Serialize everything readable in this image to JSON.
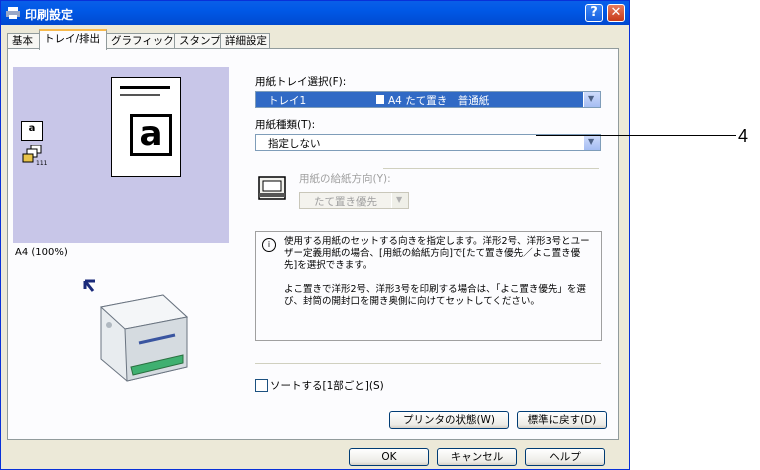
{
  "window": {
    "title": "印刷設定"
  },
  "tabs": [
    {
      "label": "基本"
    },
    {
      "label": "トレイ/排出"
    },
    {
      "label": "グラフィックス"
    },
    {
      "label": "スタンプ"
    },
    {
      "label": "詳細設定"
    }
  ],
  "preview": {
    "ratio_text": "A4 (100%)",
    "paper_letter": "a",
    "small_letter": "a"
  },
  "tray": {
    "label": "用紙トレイ選択(F):",
    "value_tray": "トレイ1",
    "value_detail": "A4 たて置き　普通紙"
  },
  "paper_type": {
    "label": "用紙種類(T):",
    "value": "指定しない"
  },
  "feed_direction": {
    "label": "用紙の給紙方向(Y):",
    "value": "たて置き優先"
  },
  "info": {
    "text1": "使用する用紙のセットする向きを指定します。洋形2号、洋形3号とユーザー定義用紙の場合、[用紙の給紙方向]で[たて置き優先／よこ置き優先]を選択できます。",
    "text2": "よこ置きで洋形2号、洋形3号を印刷する場合は、「よこ置き優先」を選び、封筒の開封口を開き奥側に向けてセットしてください。"
  },
  "sort": {
    "label": "ソートする[1部ごと](S)",
    "checked": false
  },
  "buttons": {
    "printer_status": "プリンタの状態(W)",
    "restore_defaults": "標準に戻す(D)",
    "ok": "OK",
    "cancel": "キャンセル",
    "help": "ヘルプ"
  },
  "callout": {
    "number": "4"
  },
  "colors": {
    "titlebar": "#0058e6",
    "selection": "#316ac5",
    "preview_bg": "#c8c6e8"
  }
}
